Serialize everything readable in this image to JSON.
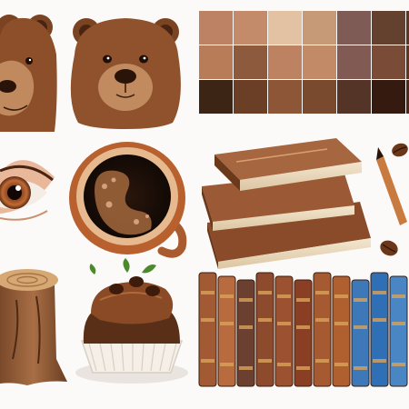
{
  "canvas": {
    "background": "#fbfaf8"
  },
  "palette": {
    "swatches": [
      [
        "#bd8163",
        "#c48b6a",
        "#e2c2a3",
        "#c79a77",
        "#7f5b56",
        "#63412e",
        "#5a3626"
      ],
      [
        "#b87c58",
        "#8e5a3e",
        "#bd8262",
        "#c28a67",
        "#805a53",
        "#7a4b36",
        "#5d3621"
      ],
      [
        "#3d2516",
        "#6a3f26",
        "#8c5637",
        "#7a4a2f",
        "#533427",
        "#351a10",
        "#4b2a1b"
      ]
    ]
  },
  "tiles": [
    {
      "name": "bear-portrait-left",
      "icon": "bear-icon"
    },
    {
      "name": "bear-portrait-center",
      "icon": "bear-icon"
    },
    {
      "name": "brown-eye",
      "icon": "eye-icon"
    },
    {
      "name": "coffee-cup",
      "icon": "coffee-cup-icon"
    },
    {
      "name": "book-stack",
      "icon": "books-icon"
    },
    {
      "name": "pencil-and-beans",
      "icon": "pencil-icon"
    },
    {
      "name": "tree-stump",
      "icon": "stump-icon"
    },
    {
      "name": "chocolate-cupcake",
      "icon": "cupcake-icon"
    },
    {
      "name": "bookshelf-spines",
      "icon": "bookshelf-icon"
    }
  ],
  "bookshelf": {
    "spine_colors": [
      "#a25a35",
      "#b86b3e",
      "#6b4030",
      "#8d4a2c",
      "#9c5230",
      "#8a3f25",
      "#a55a32",
      "#b0602f",
      "#3d78b8",
      "#2f6fb5",
      "#4a86c4"
    ]
  }
}
